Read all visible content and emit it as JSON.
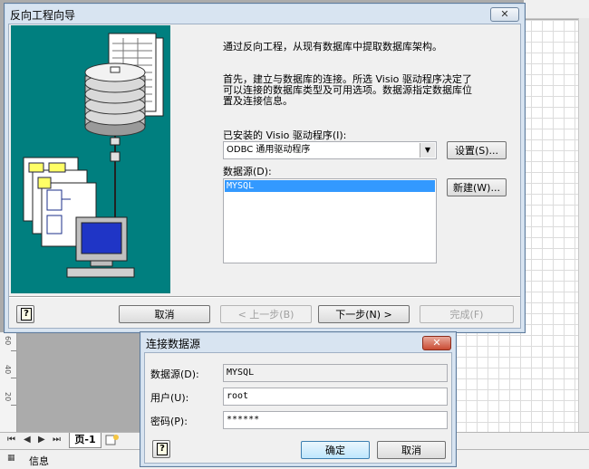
{
  "wizard": {
    "title": "反向工程向导",
    "close_label": "✕",
    "intro": "通过反向工程，从现有数据库中提取数据库架构。",
    "description_lines": [
      "首先，建立与数据库的连接。所选 Visio 驱动程序决定了",
      "可以连接的数据库类型及可用选项。数据源指定数据库位",
      "置及连接信息。"
    ],
    "driver_label": "已安装的 Visio 驱动程序(I):",
    "driver_value": "ODBC 通用驱动程序",
    "settings_button": "设置(S)...",
    "datasource_label": "数据源(D):",
    "datasource_items": [
      "MYSQL"
    ],
    "new_button": "新建(W)...",
    "cancel_button": "取消",
    "back_button": "< 上一步(B)",
    "next_button": "下一步(N) >",
    "finish_button": "完成(F)"
  },
  "connect": {
    "title": "连接数据源",
    "close_label": "✕",
    "datasource_label": "数据源(D):",
    "datasource_value": "MYSQL",
    "user_label": "用户(U):",
    "user_value": "root",
    "password_label": "密码(P):",
    "password_value": "******",
    "ok_button": "确定",
    "cancel_button": "取消"
  },
  "background": {
    "page_tab": "页-1",
    "status_text": "信息",
    "ruler_marks": [
      "60",
      "40",
      "20"
    ]
  },
  "colors": {
    "illustration_bg": "#007f7f",
    "selection": "#3399ff",
    "titlebar": "#d8e4f1"
  }
}
